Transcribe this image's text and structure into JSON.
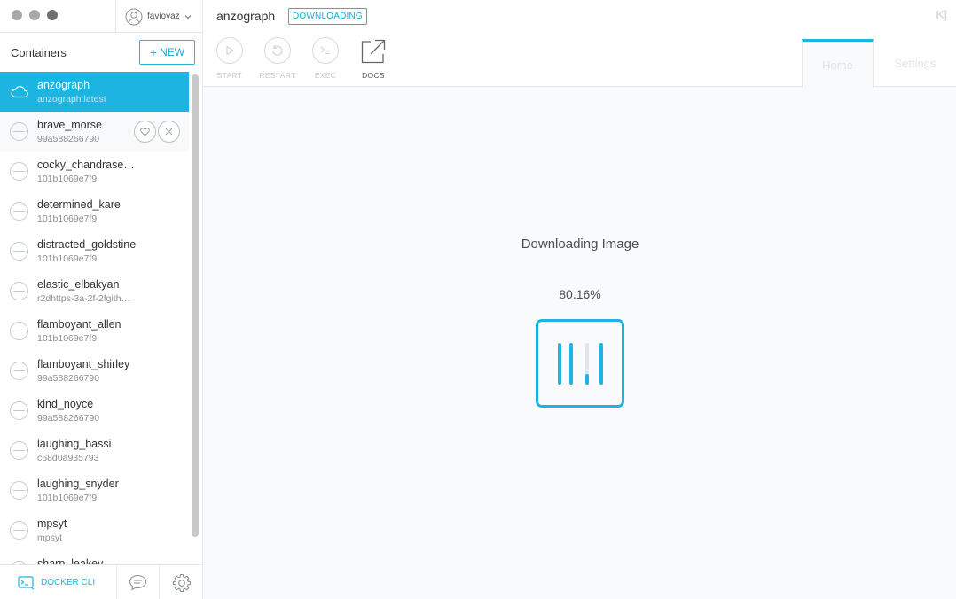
{
  "window": {
    "user": "faviovaz"
  },
  "sidebar": {
    "title": "Containers",
    "new_label": "NEW",
    "items": [
      {
        "name": "anzograph",
        "sub": "anzograph:latest",
        "state": "active"
      },
      {
        "name": "brave_morse",
        "sub": "99a588266790",
        "state": "hover"
      },
      {
        "name": "cocky_chandrase…",
        "sub": "101b1069e7f9",
        "state": "stopped"
      },
      {
        "name": "determined_kare",
        "sub": "101b1069e7f9",
        "state": "stopped"
      },
      {
        "name": "distracted_goldstine",
        "sub": "101b1069e7f9",
        "state": "stopped"
      },
      {
        "name": "elastic_elbakyan",
        "sub": "r2dhttps-3a-2f-2fgith…",
        "state": "stopped"
      },
      {
        "name": "flamboyant_allen",
        "sub": "101b1069e7f9",
        "state": "stopped"
      },
      {
        "name": "flamboyant_shirley",
        "sub": "99a588266790",
        "state": "stopped"
      },
      {
        "name": "kind_noyce",
        "sub": "99a588266790",
        "state": "stopped"
      },
      {
        "name": "laughing_bassi",
        "sub": "c68d0a935793",
        "state": "stopped"
      },
      {
        "name": "laughing_snyder",
        "sub": "101b1069e7f9",
        "state": "stopped"
      },
      {
        "name": "mpsyt",
        "sub": "mpsyt",
        "state": "stopped"
      },
      {
        "name": "sharp_leakey",
        "sub": "",
        "state": "stopped"
      }
    ],
    "footer": {
      "docker_cli": "DOCKER CLI"
    }
  },
  "main": {
    "container_name": "anzograph",
    "status_badge": "DOWNLOADING",
    "logo": "K]",
    "toolbar": {
      "start": "START",
      "restart": "RESTART",
      "exec": "EXEC",
      "docs": "DOCS"
    },
    "tabs": {
      "home": "Home",
      "settings": "Settings"
    },
    "download": {
      "title": "Downloading Image",
      "percent_label": "80.16%",
      "progress": 0.8016
    }
  },
  "colors": {
    "accent": "#1eb4e1",
    "border": "#e4e8ea"
  }
}
